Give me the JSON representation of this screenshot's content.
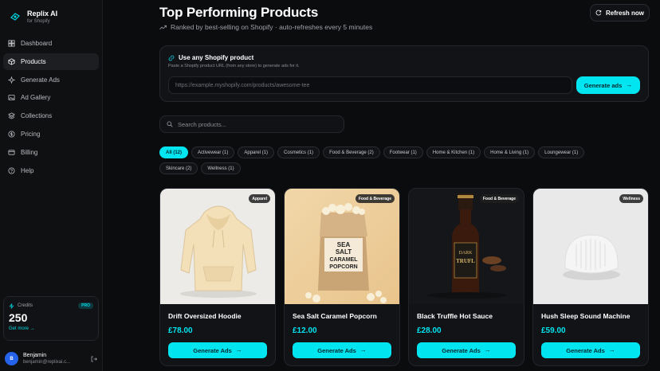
{
  "app": {
    "name": "Replix AI",
    "subtitle": "for Shopify"
  },
  "nav": [
    {
      "label": "Dashboard",
      "icon": "grid-icon"
    },
    {
      "label": "Products",
      "icon": "box-icon",
      "active": true
    },
    {
      "label": "Generate Ads",
      "icon": "sparkle-icon"
    },
    {
      "label": "Ad Gallery",
      "icon": "image-icon"
    },
    {
      "label": "Collections",
      "icon": "layers-icon"
    },
    {
      "label": "Pricing",
      "icon": "dollar-icon"
    },
    {
      "label": "Billing",
      "icon": "card-icon"
    },
    {
      "label": "Help",
      "icon": "help-icon"
    }
  ],
  "credits": {
    "label": "Credits",
    "badge": "PRO",
    "value": "250",
    "more": "Get more →"
  },
  "user": {
    "initial": "B",
    "name": "Benjamin",
    "email": "benjamin@replixai.c..."
  },
  "header": {
    "title": "Top Performing Products",
    "subtitle": "Ranked by best-selling on Shopify · auto-refreshes every 5 minutes",
    "refresh_label": "Refresh now"
  },
  "url_card": {
    "title": "Use any Shopify product",
    "description": "Paste a Shopify product URL (from any store) to generate ads for it.",
    "placeholder": "https://example.myshopify.com/products/awesome-tee",
    "button": "Generate ads"
  },
  "search": {
    "placeholder": "Search products..."
  },
  "filters": {
    "row1": [
      "All (12)",
      "Activewear (1)",
      "Apparel (1)",
      "Cosmetics (1)",
      "Food & Beverage (2)",
      "Footwear (1)",
      "Home & Kitchen (1)",
      "Home & Living (1)",
      "Loungewear (1)"
    ],
    "row2": [
      "Skincare (2)",
      "Wellness (1)"
    ]
  },
  "products": [
    {
      "name": "Drift Oversized Hoodie",
      "price": "£78.00",
      "badge": "Apparel",
      "button": "Generate Ads"
    },
    {
      "name": "Sea Salt Caramel Popcorn",
      "price": "£12.00",
      "badge": "Food & Beverage",
      "button": "Generate Ads",
      "bag_text": [
        "SEA",
        "SALT",
        "CARAMEL",
        "POPCORN"
      ]
    },
    {
      "name": "Black Truffle Hot Sauce",
      "price": "£28.00",
      "badge": "Food & Beverage",
      "button": "Generate Ads",
      "label_text": [
        "DARK",
        "TRUFL"
      ]
    },
    {
      "name": "Hush Sleep Sound Machine",
      "price": "£59.00",
      "badge": "Wellness",
      "button": "Generate Ads"
    }
  ],
  "colors": {
    "accent": "#00e5f0",
    "background": "#0b0c0e",
    "card": "#121317"
  }
}
